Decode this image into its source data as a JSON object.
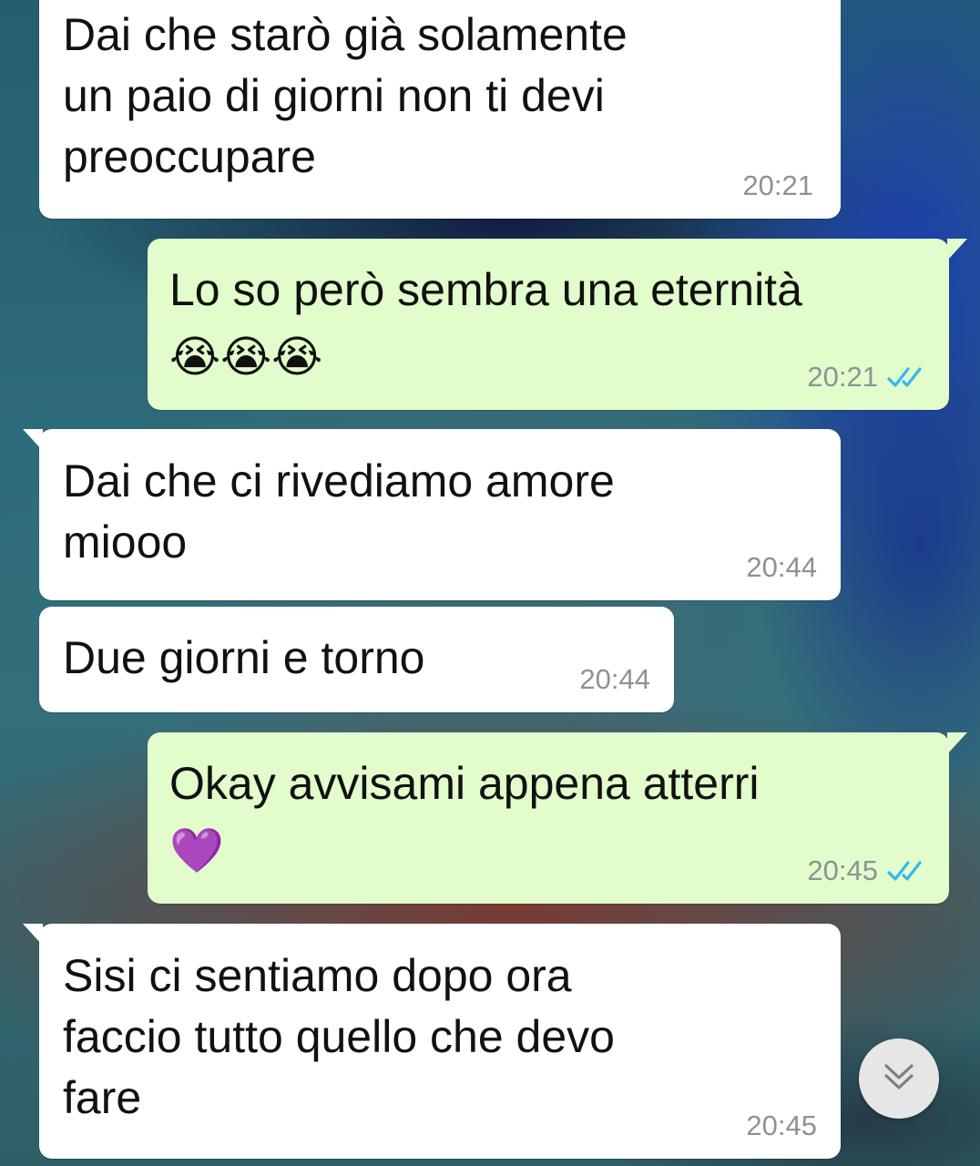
{
  "messages": [
    {
      "direction": "incoming",
      "lines": [
        "Dai che starò già solamente",
        "un paio di giorni non ti devi",
        "preoccupare"
      ],
      "time": "20:21"
    },
    {
      "direction": "outgoing",
      "lines": [
        "Lo so però sembra una eternità"
      ],
      "emoji": "😭😭😭",
      "time": "20:21",
      "status": "read"
    },
    {
      "direction": "incoming",
      "lines": [
        "Dai che ci rivediamo amore",
        "miooo"
      ],
      "time": "20:44"
    },
    {
      "direction": "incoming",
      "lines": [
        "Due giorni e torno"
      ],
      "time": "20:44"
    },
    {
      "direction": "outgoing",
      "lines": [
        "Okay avvisami appena atterri"
      ],
      "emoji": "💜",
      "time": "20:45",
      "status": "read"
    },
    {
      "direction": "incoming",
      "lines": [
        "Sisi ci sentiamo dopo ora",
        "faccio tutto quello che devo",
        "fare"
      ],
      "time": "20:45"
    }
  ],
  "colors": {
    "incoming_bubble": "#ffffff",
    "outgoing_bubble": "#e2fdcb",
    "read_tick": "#34b7f1",
    "timestamp": "#8c9295"
  },
  "icons": {
    "read_receipt": "double-check-icon",
    "scroll_down": "chevron-double-down-icon"
  }
}
